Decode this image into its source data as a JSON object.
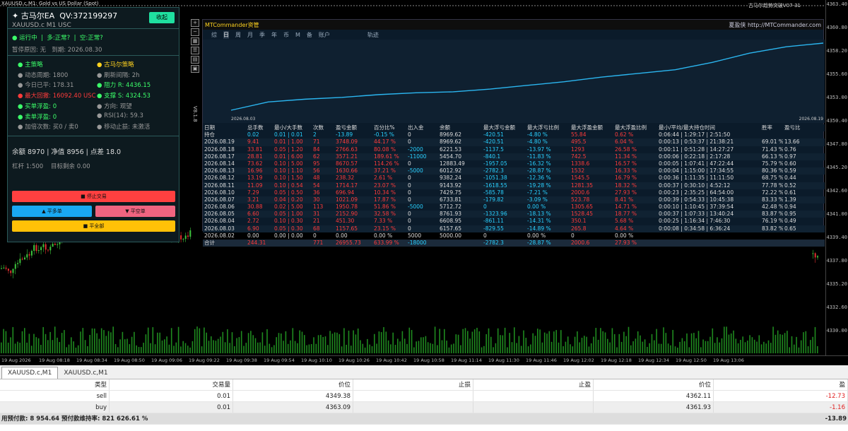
{
  "chart": {
    "title": "XAUUSD.c,M1: Gold vs US Dollar (Spot)",
    "signature": "古马尔趋势突破V07-31",
    "price_labels": [
      "4363.40",
      "4360.80",
      "4358.20",
      "4355.60",
      "4353.00",
      "4350.40",
      "4347.80",
      "4345.20",
      "4342.60",
      "4341.00",
      "4339.40",
      "4337.80",
      "4335.20",
      "4332.60",
      "4330.00"
    ],
    "time_labels": [
      "19 Aug 2026",
      "19 Aug 08:18",
      "19 Aug 08:34",
      "19 Aug 08:50",
      "19 Aug 09:06",
      "19 Aug 09:22",
      "19 Aug 09:38",
      "19 Aug 09:54",
      "19 Aug 10:10",
      "19 Aug 10:26",
      "19 Aug 10:42",
      "19 Aug 10:58",
      "19 Aug 11:14",
      "19 Aug 11:30",
      "19 Aug 11:46",
      "19 Aug 12:02",
      "19 Aug 12:18",
      "19 Aug 12:34",
      "19 Aug 12:50",
      "19 Aug 13:06"
    ],
    "current_price": "4363.40",
    "side_label": "V8.1.8"
  },
  "ea": {
    "title": "✦ 古马尔EA",
    "qv": "QV:372199297",
    "symbol": "XAUUSD.c  M1  USC",
    "collapse": "收起",
    "status_run": "运行中",
    "status_multi": "多:正常?",
    "status_short": "空:正常?",
    "pause_reason": "暂停原因: 无",
    "expiry": "到期: 2026.08.30",
    "main_title": "主策略",
    "gm_title": "古马尔策略",
    "dyn_cycle": "动态周期: 1800",
    "refresh": "刷新间隔: 2h",
    "today": "今日已平: 178.31",
    "resist": "阻力 R: 4436.15",
    "maxdd": "最大回撤: 16092.40 USC",
    "support": "支撑 S: 4324.53",
    "buy_float": "买单浮盈: 0",
    "direction": "方向: 观望",
    "sell_float": "卖单浮盈: 0",
    "rsi": "RSI(14): 59.3",
    "add_count": "加倍次数: 买0 / 卖0",
    "trail": "移动止损: 未激活",
    "summary": "余额 8970  |  净值 8956  |  点差 18.0",
    "leverage": "杠杆 1:500",
    "target": "目标剩余 0.00",
    "stop": "■ 停止交易",
    "close_long": "▲ 平多单",
    "close_short": "▼ 平空单",
    "close_all": "■ 平全部",
    "colors": {
      "stop": "#ff4040",
      "long": "#19a8f2",
      "short": "#f06480",
      "all": "#ffc107"
    }
  },
  "mtc": {
    "title": "MTCommander资管",
    "brand": "夏盈侠 http://MTCommander.com",
    "tabs": [
      "综",
      "日",
      "周",
      "月",
      "季",
      "年",
      "币",
      "M",
      "备",
      "账户",
      "轨迹"
    ],
    "equity_start": "2026.08.03",
    "equity_end": "2026.08.19",
    "equity_values": [
      5000,
      5900,
      6200,
      6400,
      6700,
      6900,
      7000,
      7300,
      7700,
      8100,
      8600,
      9000,
      9400,
      10200,
      11200,
      11900,
      12300
    ],
    "headers": [
      "日期",
      "总手数",
      "最小/大手数",
      "次数",
      "盈亏金额",
      "百分比%",
      "出入金",
      "余额",
      "最大浮亏金额",
      "最大浮亏比例",
      "最大浮盈金额",
      "最大浮盈比例",
      "最小/平均/最大持仓时间",
      "胜率",
      "盈亏比"
    ],
    "rows": [
      [
        "持仓",
        "0.02",
        "0.01 | 0.01",
        "2",
        "-13.89",
        "-0.15 %",
        "0",
        "8969.62",
        "-420.51",
        "-4.80 %",
        "55.84",
        "0.62 %",
        "0:06:44 | 1:29:17 | 2:51:50",
        "",
        ""
      ],
      [
        "2026.08.19",
        "9.41",
        "0.01 | 1.00",
        "71",
        "3748.09",
        "44.17 %",
        "0",
        "8969.62",
        "-420.51",
        "-4.80 %",
        "495.5",
        "6.04 %",
        "0:00:13 | 0:53:37 | 21:38:21",
        "69.01 %",
        "13.66"
      ],
      [
        "2026.08.18",
        "33.81",
        "0.05 | 1.20",
        "84",
        "2766.63",
        "80.08 %",
        "-2000",
        "6221.53",
        "-1137.5",
        "-13.97 %",
        "1293",
        "26.58 %",
        "0:00:11 | 0:51:28 | 14:27:27",
        "71.43 %",
        "0.76"
      ],
      [
        "2026.08.17",
        "28.81",
        "0.01 | 6.00",
        "62",
        "3571.21",
        "189.61 %",
        "-11000",
        "5454.70",
        "-840.1",
        "-11.83 %",
        "742.5",
        "11.34 %",
        "0:00:06 | 0:22:18 | 2:17:28",
        "66.13 %",
        "0.97"
      ],
      [
        "2026.08.14",
        "73.62",
        "0.10 | 5.00",
        "95",
        "8670.57",
        "114.26 %",
        "0",
        "12883.49",
        "-1957.05",
        "-16.32 %",
        "1338.6",
        "16.57 %",
        "0:00:05 | 1:07:41 | 47:22:44",
        "75.79 %",
        "0.60"
      ],
      [
        "2026.08.13",
        "16.96",
        "0.10 | 1.10",
        "56",
        "1630.66",
        "37.21 %",
        "-5000",
        "6012.92",
        "-2782.3",
        "-28.87 %",
        "1532",
        "16.33 %",
        "0:00:04 | 1:15:00 | 17:34:55",
        "80.36 %",
        "0.59"
      ],
      [
        "2026.08.12",
        "13.19",
        "0.10 | 1.50",
        "48",
        "238.32",
        "2.61 %",
        "0",
        "9382.24",
        "-1051.38",
        "-12.36 %",
        "1545.5",
        "16.79 %",
        "0:00:36 | 1:11:35 | 11:11:50",
        "68.75 %",
        "0.44"
      ],
      [
        "2026.08.11",
        "11.09",
        "0.10 | 0.54",
        "54",
        "1714.17",
        "23.07 %",
        "0",
        "9143.92",
        "-1618.55",
        "-19.28 %",
        "1281.35",
        "18.32 %",
        "0:00:37 | 0:30:10 | 4:52:12",
        "77.78 %",
        "0.52"
      ],
      [
        "2026.08.10",
        "7.29",
        "0.05 | 0.50",
        "36",
        "696.94",
        "10.34 %",
        "0",
        "7429.75",
        "-585.78",
        "-7.21 %",
        "2000.6",
        "27.93 %",
        "0:00:23 | 2:35:25 | 64:54:00",
        "72.22 %",
        "0.61"
      ],
      [
        "2026.08.07",
        "3.21",
        "0.04 | 0.20",
        "30",
        "1021.09",
        "17.87 %",
        "0",
        "6733.81",
        "-179.82",
        "-3.09 %",
        "523.78",
        "8.41 %",
        "0:00:39 | 0:54:33 | 10:45:38",
        "83.33 %",
        "1.39"
      ],
      [
        "2026.08.06",
        "30.88",
        "0.02 | 5.00",
        "113",
        "1950.78",
        "51.86 %",
        "-5000",
        "5712.72",
        "0",
        "0.00 %",
        "1305.65",
        "14.71 %",
        "0:00:10 | 1:10:45 | 37:39:54",
        "42.48 %",
        "0.94"
      ],
      [
        "2026.08.05",
        "6.60",
        "0.05 | 1.00",
        "31",
        "2152.90",
        "32.58 %",
        "0",
        "8761.93",
        "-1323.96",
        "-18.13 %",
        "1528.45",
        "18.77 %",
        "0:00:37 | 1:07:33 | 13:40:24",
        "83.87 %",
        "0.95"
      ],
      [
        "2026.08.04",
        "2.72",
        "0.10 | 0.30",
        "21",
        "451.30",
        "7.33 %",
        "0",
        "6608.95",
        "-861.11",
        "-14.31 %",
        "350.1",
        "5.68 %",
        "0:00:25 | 1:16:34 | 7:46:30",
        "76.19 %",
        "0.49"
      ],
      [
        "2026.08.03",
        "6.90",
        "0.05 | 0.30",
        "68",
        "1157.65",
        "23.15 %",
        "0",
        "6157.65",
        "-829.55",
        "-14.89 %",
        "265.8",
        "4.64 %",
        "0:00:08 | 0:34:58 | 6:36:24",
        "83.82 %",
        "0.65"
      ],
      [
        "2026.08.02",
        "0.00",
        "0.00 | 0.00",
        "0",
        "0.00",
        "0.00 %",
        "5000",
        "5000.00",
        "0",
        "0.00 %",
        "0",
        "0.00 %",
        "",
        "",
        ""
      ],
      [
        "合计",
        "244.31",
        "",
        "771",
        "26955.73",
        "633.99 %",
        "-18000",
        "",
        "-2782.3",
        "-28.87 %",
        "2000.6",
        "27.93 %",
        "",
        "",
        ""
      ]
    ]
  },
  "tabs": [
    "XAUUSD.c,M1",
    "XAUUSD.c,M1"
  ],
  "orders": {
    "headers": [
      "类型",
      "交易量",
      "价位",
      "止损",
      "止盈",
      "价位",
      "盈"
    ],
    "rows": [
      [
        "sell",
        "0.01",
        "4349.38",
        "",
        "",
        "4362.11",
        "-12.73"
      ],
      [
        "buy",
        "0.01",
        "4363.09",
        "",
        "",
        "4361.93",
        "-1.16"
      ]
    ],
    "footer": "用预付款: 8 954.64  预付款维持率: 821 626.61 %",
    "footer_total": "-13.89"
  }
}
